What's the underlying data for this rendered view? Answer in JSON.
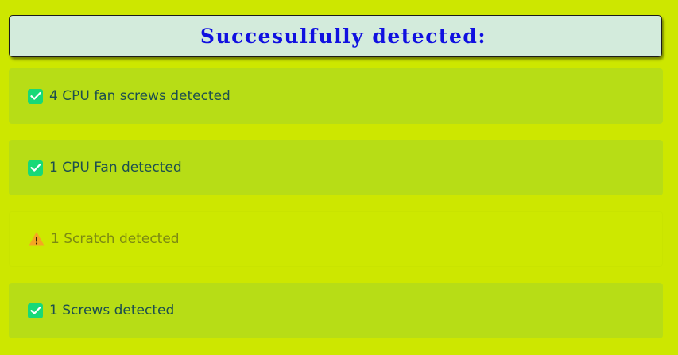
{
  "header": {
    "title": "Succesulfully detected:"
  },
  "items": [
    {
      "status": "success",
      "icon": "check-icon",
      "label": "4 CPU fan screws detected"
    },
    {
      "status": "success",
      "icon": "check-icon",
      "label": "1 CPU Fan detected"
    },
    {
      "status": "warning",
      "icon": "warning-icon",
      "label": "1 Scratch detected"
    },
    {
      "status": "success",
      "icon": "check-icon",
      "label": "1 Screws detected"
    }
  ],
  "colors": {
    "background": "#cde700",
    "header_bg": "#d3ebdc",
    "title": "#1010e0",
    "success_bg": "#b7dd16",
    "check": "#17d977",
    "success_text": "#1d4f4f",
    "warning_text": "#7c8a12",
    "warning_icon": "#f5a623"
  }
}
